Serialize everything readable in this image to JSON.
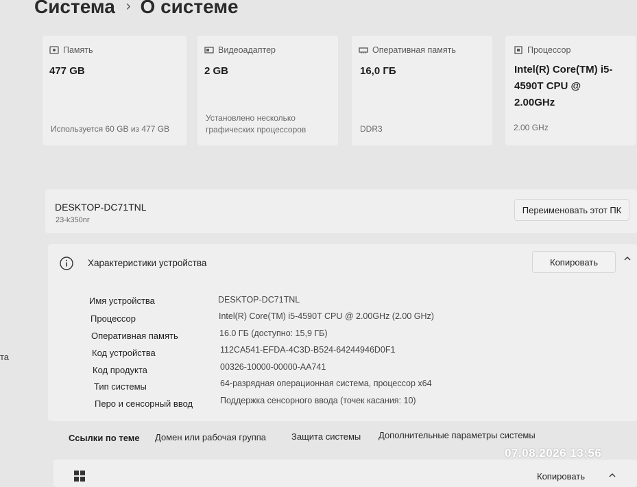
{
  "breadcrumb": {
    "parent": "Система",
    "separator": "›",
    "current": "О системе"
  },
  "tiles": [
    {
      "icon": "storage-icon",
      "title": "Память",
      "value": "477 GB",
      "sub": "Используется 60 GB из 477 GB"
    },
    {
      "icon": "gpu-icon",
      "title": "Видеоадаптер",
      "value": "2 GB",
      "sub": "Установлено несколько графических процессоров"
    },
    {
      "icon": "ram-icon",
      "title": "Оперативная память",
      "value": "16,0 ГБ",
      "sub": "DDR3"
    },
    {
      "icon": "cpu-icon",
      "title": "Процессор",
      "value": "Intel(R) Core(TM) i5-4590T CPU @ 2.00GHz",
      "sub": "2.00 GHz"
    }
  ],
  "device": {
    "name": "DESKTOP-DC71TNL",
    "model": "23-k350nr",
    "rename_label": "Переименовать этот ПК"
  },
  "side_fragment": "та",
  "specs": {
    "title": "Характеристики устройства",
    "copy_label": "Копировать",
    "rows": [
      {
        "label": "Имя устройства",
        "value": "DESKTOP-DC71TNL"
      },
      {
        "label": "Процессор",
        "value": "Intel(R) Core(TM) i5-4590T CPU @ 2.00GHz (2.00 GHz)"
      },
      {
        "label": "Оперативная память",
        "value": "16.0 ГБ (доступно: 15,9 ГБ)"
      },
      {
        "label": "Код устройства",
        "value": "112CA541-EFDA-4C3D-B524-64244946D0F1"
      },
      {
        "label": "Код продукта",
        "value": "00326-10000-00000-AA741"
      },
      {
        "label": "Тип системы",
        "value": "64-разрядная операционная система, процессор x64"
      },
      {
        "label": "Перо и сенсорный ввод",
        "value": "Поддержка сенсорного ввода (точек касания: 10)"
      }
    ]
  },
  "related": {
    "title": "Ссылки по теме",
    "links": [
      "Домен или рабочая группа",
      "Защита системы",
      "Дополнительные параметры системы"
    ]
  },
  "bottom": {
    "copy_label": "Копировать"
  },
  "photo_timestamp": "07.08.2026 13:56"
}
